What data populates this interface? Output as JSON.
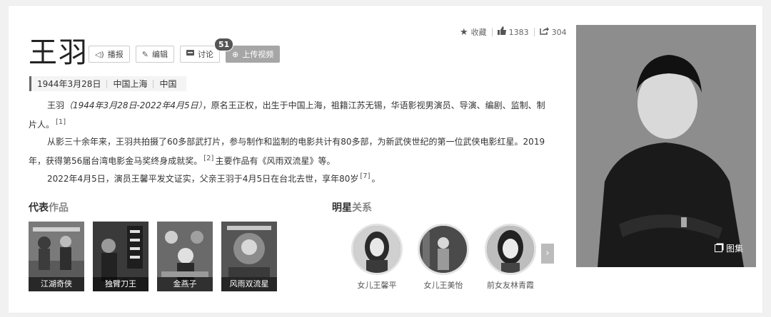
{
  "stats": {
    "favorite_label": "收藏",
    "likes": "1383",
    "shares": "304"
  },
  "person": {
    "name": "王羽"
  },
  "toolbar": {
    "broadcast_label": "播报",
    "edit_label": "编辑",
    "discuss_label": "讨论",
    "discuss_count": "51",
    "upload_label": "上传视频"
  },
  "info": {
    "birth_date": "1944年3月28日",
    "birth_place": "中国上海",
    "country": "中国"
  },
  "paragraphs": {
    "p1_name": "王羽",
    "p1_dates": "（1944年3月28日-2022年4月5日）",
    "p1_text": "，原名王正权，出生于中国上海，祖籍江苏无锡，华语影视男演员、导演、编剧、监制、制片人。",
    "p1_ref": "[1]",
    "p2_text_a": "从影三十余年来，王羽共拍摄了60多部武打片，参与制作和监制的电影共计有80多部，为新武侠世纪的第一位武侠电影红星。2019年，获得第56届台湾电影金马奖终身成就奖。",
    "p2_ref": "[2]",
    "p2_text_b": "主要作品有《风雨双流星》等。",
    "p3_text": "2022年4月5日，演员王馨平发文证实，父亲王羽于4月5日在台北去世，享年80岁",
    "p3_ref": "[7]",
    "p3_end": "。"
  },
  "works_section": {
    "title_a": "代表",
    "title_b": "作品"
  },
  "works": [
    "江湖奇侠",
    "独臂刀王",
    "金燕子",
    "风雨双流星"
  ],
  "relations_section": {
    "title_a": "明星",
    "title_b": "关系"
  },
  "relations": [
    "女儿王馨平",
    "女儿王美怡",
    "前女友林青霞"
  ],
  "gallery": {
    "label": "图集"
  },
  "colors": {
    "accent_bar": "#666666",
    "upload_button": "#a6a6a6"
  }
}
